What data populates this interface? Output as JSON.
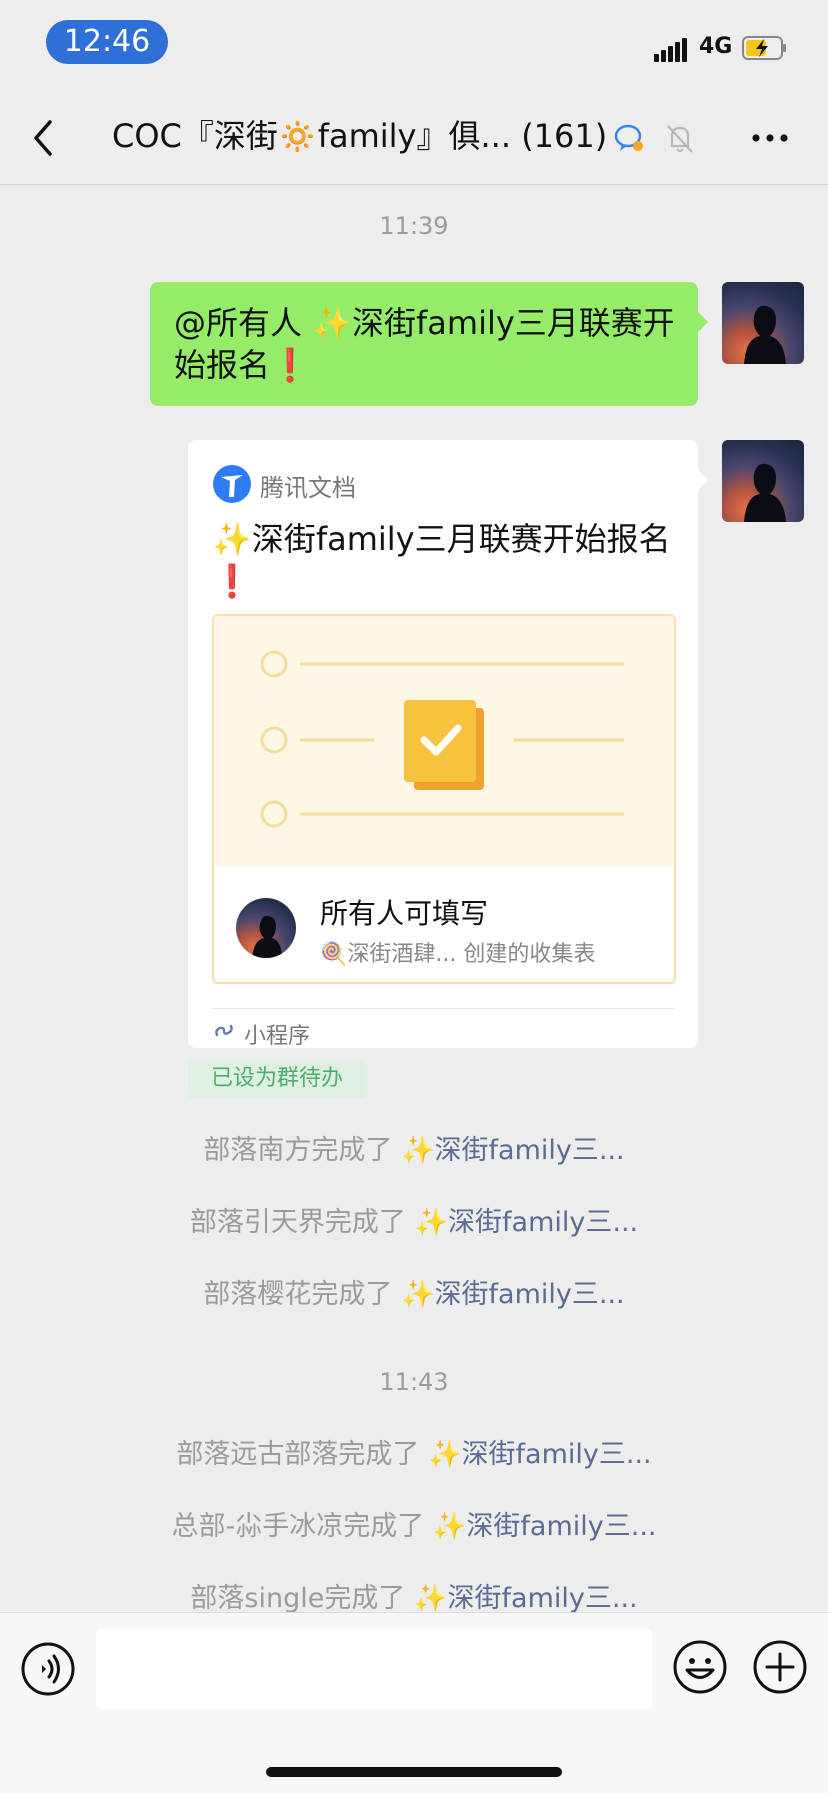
{
  "status_bar": {
    "time": "12:46",
    "network": "4G"
  },
  "nav": {
    "title": "COC『深街🔅family』俱...",
    "member_count": "(161)"
  },
  "messages": {
    "time1": "11:39",
    "text_msg": "@所有人 ✨深街family三月联赛开始报名❗",
    "card": {
      "source": "腾讯文档",
      "title": "✨深街family三月联赛开始报名❗",
      "preview_title": "所有人可填写",
      "preview_subtitle": "🍭深街酒肆... 创建的收集表",
      "app_type": "小程序"
    },
    "todo_badge": "已设为群待办",
    "completions_a": [
      {
        "who": "部落南方完成了 ",
        "link": "✨深街family三..."
      },
      {
        "who": "部落引天界完成了 ",
        "link": "✨深街family三..."
      },
      {
        "who": "部落樱花完成了 ",
        "link": "✨深街family三..."
      }
    ],
    "time2": "11:43",
    "completions_b": [
      {
        "who": "部落远古部落完成了 ",
        "link": "✨深街family三..."
      },
      {
        "who": "总部-尛手冰凉完成了 ",
        "link": "✨深街family三..."
      },
      {
        "who": "部落single完成了 ",
        "link": "✨深街family三..."
      }
    ]
  },
  "input": {
    "placeholder": ""
  }
}
